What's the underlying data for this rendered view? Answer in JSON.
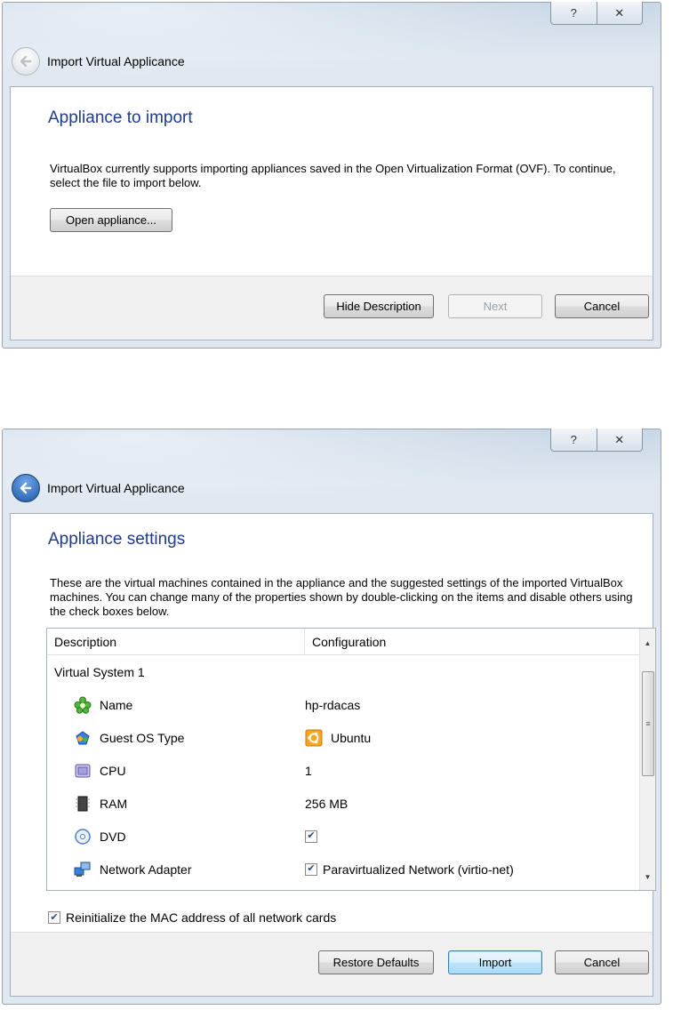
{
  "window1": {
    "help_glyph": "?",
    "close_glyph": "✕",
    "title": "Import Virtual Applicance",
    "heading": "Appliance to import",
    "description": "VirtualBox currently supports importing appliances saved in the Open Virtualization Format (OVF). To continue, select the file to import below.",
    "open_button": "Open appliance...",
    "footer": {
      "hide_description": "Hide Description",
      "next": "Next",
      "cancel": "Cancel"
    }
  },
  "window2": {
    "help_glyph": "?",
    "close_glyph": "✕",
    "title": "Import Virtual Applicance",
    "heading": "Appliance settings",
    "description": "These are the virtual machines contained in the appliance and the suggested settings of the imported VirtualBox machines. You can change many of the properties shown by double-clicking on the items and disable others using the check boxes below.",
    "table": {
      "columns": [
        "Description",
        "Configuration"
      ],
      "group": "Virtual System 1",
      "rows": [
        {
          "label": "Name",
          "value": "hp-rdacas",
          "icon": "name-icon"
        },
        {
          "label": "Guest OS Type",
          "value": "Ubuntu",
          "icon": "guest-os-icon",
          "value_icon": "ubuntu-icon"
        },
        {
          "label": "CPU",
          "value": "1",
          "icon": "cpu-icon"
        },
        {
          "label": "RAM",
          "value": "256 MB",
          "icon": "ram-icon"
        },
        {
          "label": "DVD",
          "value": "",
          "icon": "dvd-icon",
          "checked": true
        },
        {
          "label": "Network Adapter",
          "value": "Paravirtualized Network (virtio-net)",
          "icon": "network-adapter-icon",
          "checked": true
        }
      ]
    },
    "reinit_mac_label": "Reinitialize the MAC address of all network cards",
    "reinit_mac_checked": true,
    "footer": {
      "restore_defaults": "Restore Defaults",
      "import": "Import",
      "cancel": "Cancel"
    }
  }
}
